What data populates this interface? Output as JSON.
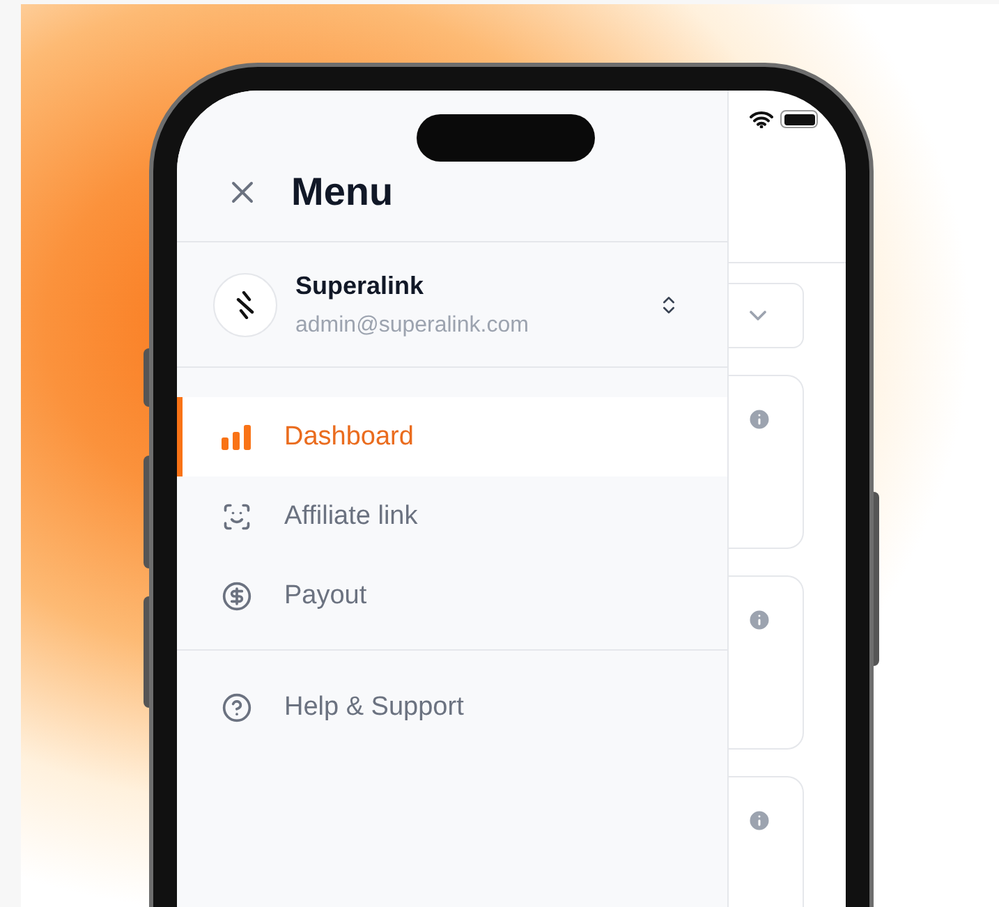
{
  "menu": {
    "title": "Menu"
  },
  "account": {
    "name": "Superalink",
    "email": "admin@superalink.com"
  },
  "nav_sections": [
    {
      "items": [
        {
          "label": "Dashboard",
          "selected": true
        },
        {
          "label": "Affiliate link",
          "selected": false
        },
        {
          "label": "Payout",
          "selected": false
        }
      ]
    },
    {
      "items": [
        {
          "label": "Help & Support",
          "selected": false
        }
      ]
    }
  ]
}
